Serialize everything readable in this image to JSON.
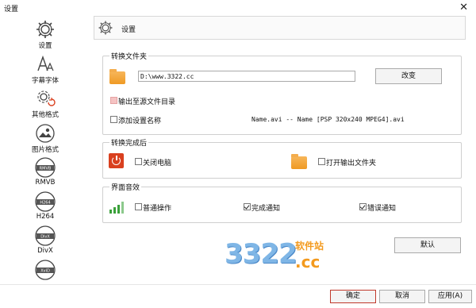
{
  "window": {
    "title": "设置",
    "close_glyph": "✕"
  },
  "sidebar": {
    "items": [
      {
        "label": "设置",
        "icon": "gear-icon"
      },
      {
        "label": "字幕字体",
        "icon": "font-icon"
      },
      {
        "label": "其他格式",
        "icon": "gear-refresh-icon"
      },
      {
        "label": "图片格式",
        "icon": "image-icon"
      },
      {
        "label": "RMVB",
        "icon": "rmvb-icon",
        "badge": "RMVB"
      },
      {
        "label": "H264",
        "icon": "h264-icon",
        "badge": "H264"
      },
      {
        "label": "DivX",
        "icon": "divx-icon",
        "badge": "DivX"
      },
      {
        "label": "XviD",
        "icon": "xvid-icon",
        "badge": "XviD"
      }
    ]
  },
  "header": {
    "title": "设置"
  },
  "convert_folder": {
    "legend": "转换文件夹",
    "path_value": "D:\\www.3322.cc",
    "change_button": "改变",
    "output_to_source_label": "输出至源文件目录",
    "add_name_label": "添加设置名称",
    "name_example": "Name.avi  -- Name [PSP 320x240 MPEG4].avi"
  },
  "after_convert": {
    "legend": "转换完成后",
    "shutdown_label": "关闭电脑",
    "open_folder_label": "打开输出文件夹"
  },
  "sound": {
    "legend": "界面音效",
    "normal_label": "普通操作",
    "complete_label": "完成通知",
    "error_label": "错误通知"
  },
  "default_button": "默认",
  "footer": {
    "ok": "确定",
    "cancel": "取消",
    "apply": "应用(A)"
  },
  "watermark": {
    "digits": "3322",
    "cn": "软件站",
    "cc": ".cc"
  },
  "colors": {
    "folder": "#f0a030",
    "power": "#d9401f",
    "signal": "#3aa03a",
    "primary_border": "#c0392b",
    "watermark_blue": "#7fb6e6",
    "watermark_orange": "#f39a1e"
  }
}
